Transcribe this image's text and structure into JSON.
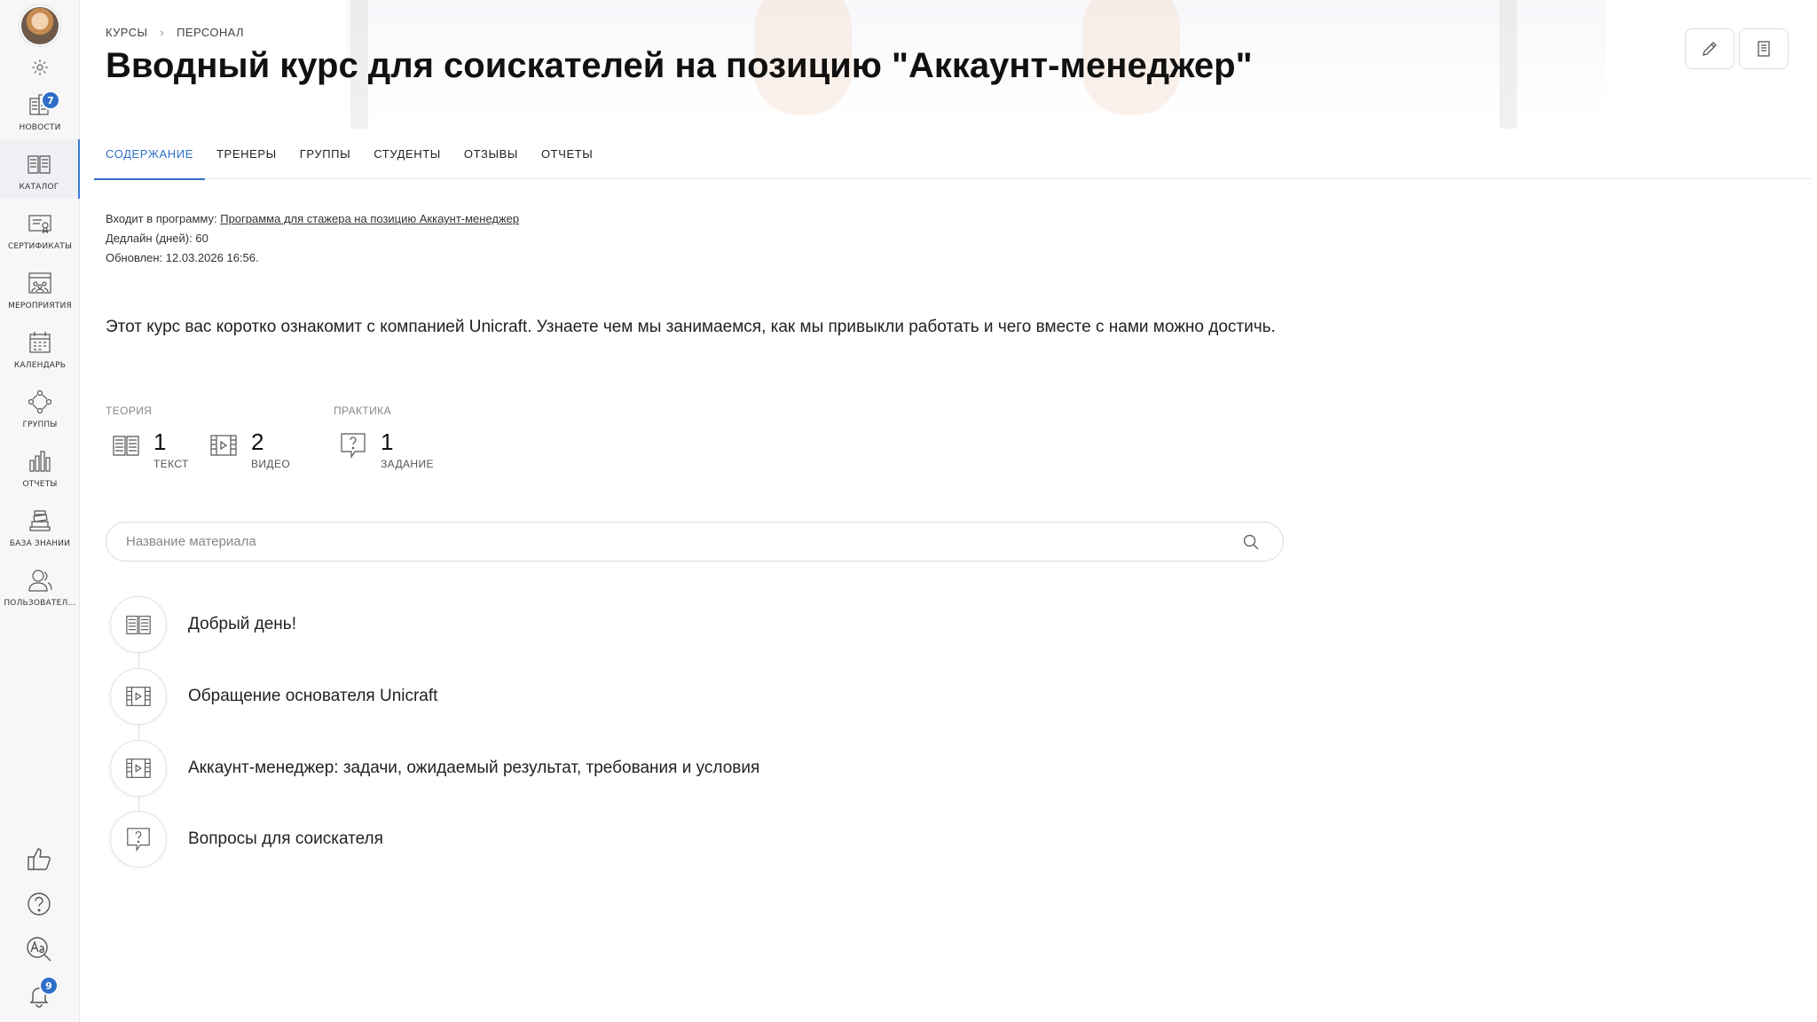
{
  "sidebar": {
    "news_badge": "7",
    "notifications_badge": "9",
    "items": [
      {
        "label": "Новости",
        "icon": "news-icon"
      },
      {
        "label": "Каталог",
        "icon": "catalog-icon"
      },
      {
        "label": "Сертификаты",
        "icon": "certificate-icon"
      },
      {
        "label": "Мероприятия",
        "icon": "events-icon"
      },
      {
        "label": "Календарь",
        "icon": "calendar-icon"
      },
      {
        "label": "Группы",
        "icon": "groups-icon"
      },
      {
        "label": "Отчеты",
        "icon": "reports-icon"
      },
      {
        "label": "База знаний",
        "icon": "knowledge-base-icon"
      },
      {
        "label": "Пользовател...",
        "icon": "users-icon"
      }
    ],
    "active_item": "Каталог"
  },
  "breadcrumb": {
    "items": [
      "КУРСЫ",
      "ПЕРСОНАЛ"
    ]
  },
  "page": {
    "title": "Вводный курс для соискателей на позицию \"Аккаунт-менеджер\""
  },
  "tabs": [
    {
      "label": "СОДЕРЖАНИЕ",
      "active": true
    },
    {
      "label": "ТРЕНЕРЫ",
      "active": false
    },
    {
      "label": "ГРУППЫ",
      "active": false
    },
    {
      "label": "СТУДЕНТЫ",
      "active": false
    },
    {
      "label": "ОТЗЫВЫ",
      "active": false
    },
    {
      "label": "ОТЧЕТЫ",
      "active": false
    }
  ],
  "meta": {
    "program_prefix": "Входит в программу:",
    "program_link": "Программа для стажера на позицию Аккаунт-менеджер",
    "deadline": "Дедлайн (дней): 60",
    "updated": "Обновлен: 12.03.2026 16:56."
  },
  "description": "Этот курс вас коротко ознакомит с компанией Unicraft. Узнаете чем мы занимаемся, как мы привыкли работать и чего вместе с нами можно достичь.",
  "stats": {
    "theory_label": "ТЕОРИЯ",
    "practice_label": "ПРАКТИКА",
    "text": {
      "count": "1",
      "label": "ТЕКСТ"
    },
    "video": {
      "count": "2",
      "label": "ВИДЕО"
    },
    "task": {
      "count": "1",
      "label": "ЗАДАНИЕ"
    }
  },
  "search": {
    "placeholder": "Название материала",
    "value": ""
  },
  "materials": [
    {
      "title": "Добрый день!",
      "type": "text",
      "icon": "book-icon"
    },
    {
      "title": "Обращение основателя Unicraft",
      "type": "video",
      "icon": "video-icon"
    },
    {
      "title": "Аккаунт-менеджер: задачи, ожидаемый результат, требования и условия",
      "type": "video",
      "icon": "video-icon"
    },
    {
      "title": "Вопросы для соискателя",
      "type": "task",
      "icon": "question-icon"
    }
  ],
  "colors": {
    "accent": "#2f6fc9",
    "badge": "#2f6fc9",
    "sidebar_bg": "#f7f7f8"
  }
}
